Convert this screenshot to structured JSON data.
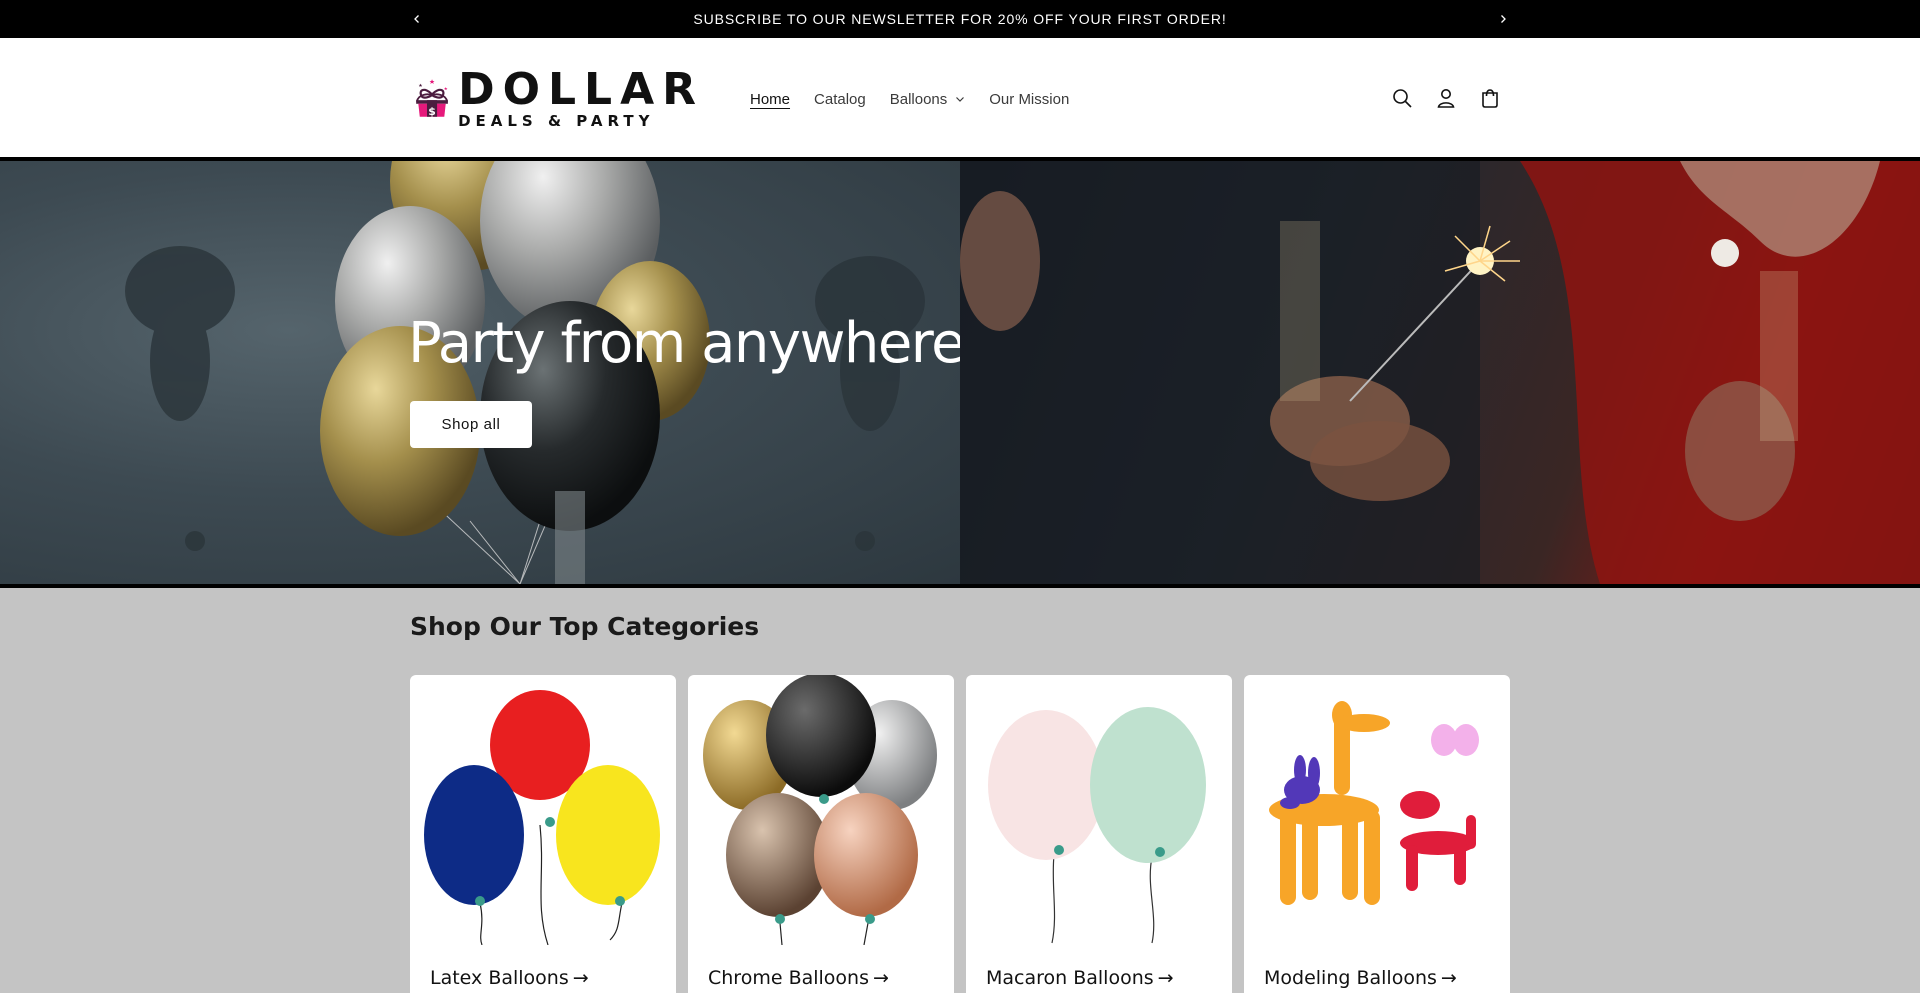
{
  "announcement": {
    "message": "SUBSCRIBE TO OUR NEWSLETTER FOR 20% OFF YOUR FIRST ORDER!"
  },
  "brand": {
    "name_line1": "DOLLAR",
    "name_line2": "DEALS & PARTY",
    "mark_letter": "$",
    "colors": {
      "pink": "#e6197b",
      "purple": "#4b1d3f",
      "dark": "#111111"
    }
  },
  "nav": {
    "items": [
      {
        "label": "Home",
        "active": true
      },
      {
        "label": "Catalog",
        "active": false
      },
      {
        "label": "Balloons",
        "active": false,
        "has_dropdown": true
      },
      {
        "label": "Our Mission",
        "active": false
      }
    ]
  },
  "header_icons": [
    "search-icon",
    "account-icon",
    "cart-icon"
  ],
  "hero": {
    "heading": "Party from anywhere.",
    "button_label": "Shop all"
  },
  "categories": {
    "title": "Shop Our Top Categories",
    "items": [
      {
        "label": "Latex Balloons",
        "arrow": "→"
      },
      {
        "label": "Chrome Balloons",
        "arrow": "→"
      },
      {
        "label": "Macaron Balloons",
        "arrow": "→"
      },
      {
        "label": "Modeling Balloons",
        "arrow": "→"
      }
    ]
  }
}
